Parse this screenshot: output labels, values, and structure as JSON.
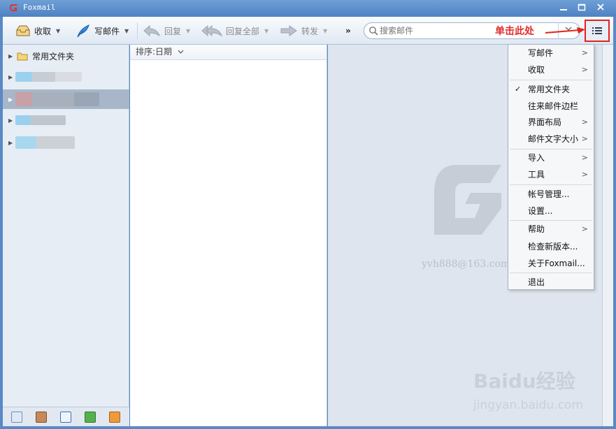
{
  "window": {
    "title": "Foxmail"
  },
  "toolbar": {
    "receive": "收取",
    "compose": "写邮件",
    "reply": "回复",
    "reply_all": "回复全部",
    "forward": "转发",
    "more": "»"
  },
  "search": {
    "placeholder": "搜索邮件"
  },
  "annotation": {
    "text": "单击此处"
  },
  "folders": {
    "common": "常用文件夹"
  },
  "list": {
    "sort_label": "排序:日期"
  },
  "reading": {
    "email_watermark": "yvh888@163.com",
    "baidu_logo": "Baidu经验",
    "baidu_url": "jingyan.baidu.com"
  },
  "menu": {
    "items": [
      {
        "label": "写邮件",
        "submenu": true
      },
      {
        "label": "收取",
        "submenu": true
      },
      {
        "label": "常用文件夹",
        "checked": true
      },
      {
        "label": "往来邮件边栏"
      },
      {
        "label": "界面布局",
        "submenu": true
      },
      {
        "label": "邮件文字大小",
        "submenu": true
      },
      {
        "label": "导入",
        "submenu": true
      },
      {
        "label": "工具",
        "submenu": true
      },
      {
        "label": "帐号管理..."
      },
      {
        "label": "设置..."
      },
      {
        "label": "帮助",
        "submenu": true
      },
      {
        "label": "检查新版本..."
      },
      {
        "label": "关于Foxmail..."
      },
      {
        "label": "退出"
      }
    ],
    "submenu_glyph": ">",
    "check_glyph": "✓"
  }
}
